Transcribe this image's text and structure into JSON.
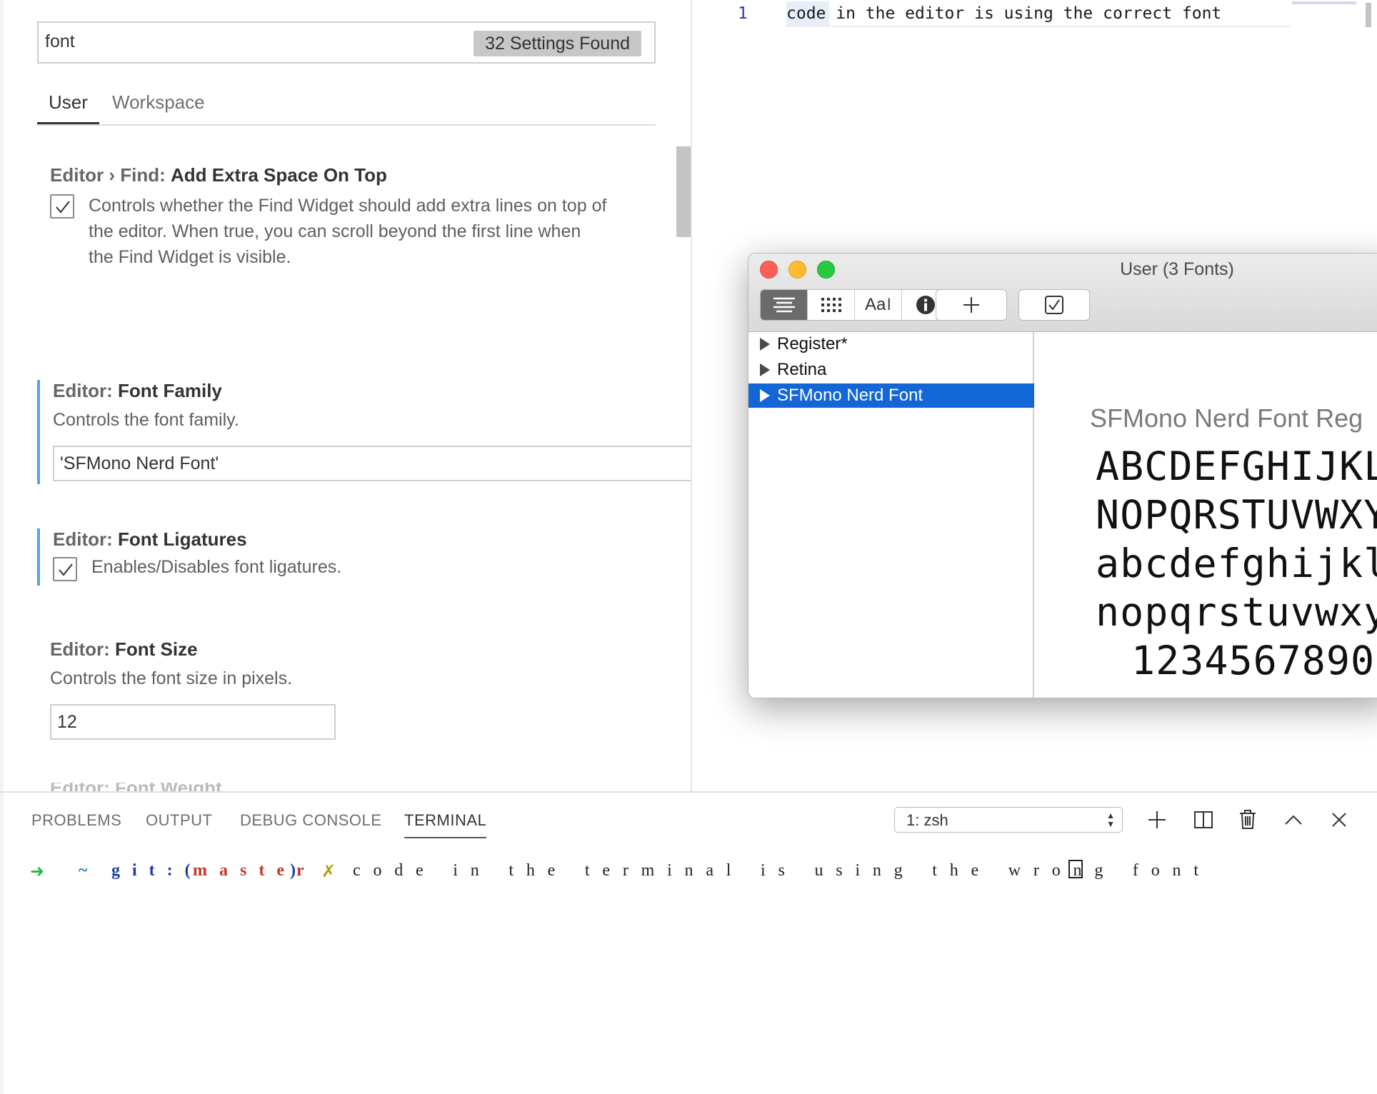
{
  "settings": {
    "search": {
      "query": "font",
      "results_badge": "32 Settings Found"
    },
    "scope_tabs": [
      {
        "label": "User"
      },
      {
        "label": "Workspace"
      }
    ],
    "items": [
      {
        "category": "Editor › Find:",
        "key": "Add Extra Space On Top",
        "description_lines": [
          "Controls whether the Find Widget should add extra lines on top of",
          "the editor. When true, you can scroll beyond the first line when",
          "the Find Widget is visible."
        ],
        "checked": true
      },
      {
        "category": "Editor:",
        "key": "Font Family",
        "description": "Controls the font family.",
        "value": "'SFMono Nerd Font'"
      },
      {
        "category": "Editor:",
        "key": "Font Ligatures",
        "description": "Enables/Disables font ligatures.",
        "checked": true
      },
      {
        "category": "Editor:",
        "key": "Font Size",
        "description": "Controls the font size in pixels.",
        "value": "12"
      }
    ],
    "cut_off_title": "Editor: Font Weight"
  },
  "editor": {
    "line_number": "1",
    "line_text": "code in the editor is using the correct font"
  },
  "font_book": {
    "title": "User (3 Fonts)",
    "toolbar_icons": [
      "list-view-icon",
      "grid-view-icon",
      "sample-text-icon",
      "info-icon",
      "add-icon",
      "validate-icon"
    ],
    "sample_icon_text": "Aa",
    "fonts": [
      {
        "name": "Register*",
        "selected": false
      },
      {
        "name": "Retina",
        "selected": false
      },
      {
        "name": "SFMono Nerd Font",
        "selected": true
      }
    ],
    "preview": {
      "font_name": "SFMono Nerd Font Reg",
      "lines": [
        "ABCDEFGHIJKL",
        "NOPQRSTUVWXY",
        "abcdefghijkl",
        "nopqrstuvwxy",
        "1234567890"
      ]
    },
    "colors": {
      "selection": "#1266d6"
    }
  },
  "panel": {
    "tabs": [
      {
        "label": "PROBLEMS"
      },
      {
        "label": "OUTPUT"
      },
      {
        "label": "DEBUG CONSOLE"
      },
      {
        "label": "TERMINAL",
        "active": true
      }
    ],
    "terminal_select": "1: zsh",
    "terminal": {
      "arrow": "➜",
      "tilde": "~",
      "git_prefix": "git:(",
      "branch": "master",
      "git_suffix": ")",
      "dirty": "✗",
      "command": "code in the terminal is using the wrong font"
    }
  }
}
